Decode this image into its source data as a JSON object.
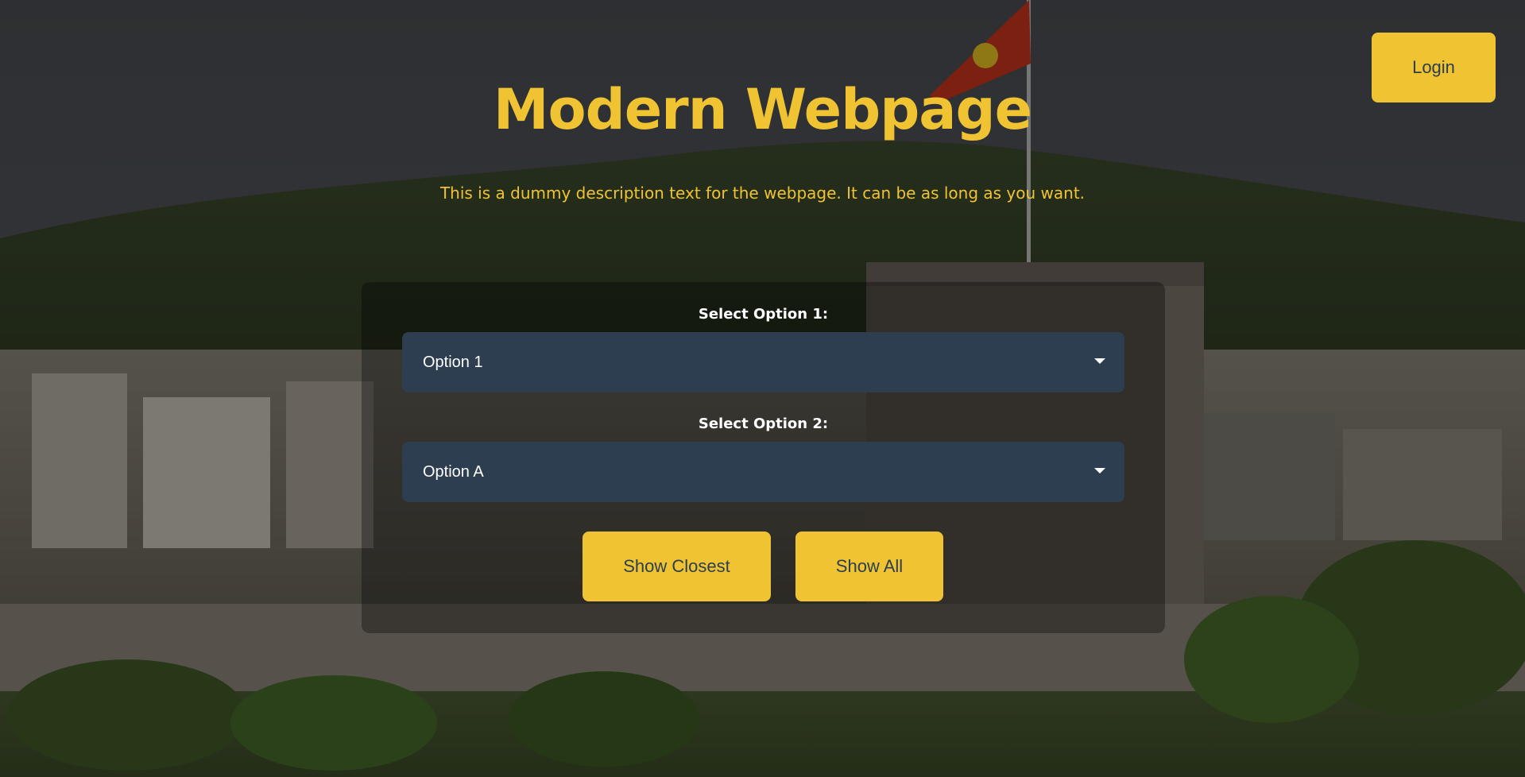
{
  "header": {
    "login_label": "Login"
  },
  "hero": {
    "title": "Modern Webpage",
    "description": "This is a dummy description text for the webpage. It can be as long as you want."
  },
  "form": {
    "option1": {
      "label": "Select Option 1:",
      "selected_value": "Option 1"
    },
    "option2": {
      "label": "Select Option 2:",
      "selected_value": "Option A"
    },
    "buttons": {
      "show_closest_label": "Show Closest",
      "show_all_label": "Show All"
    }
  },
  "icons": {
    "select_caret": "chevron-down-icon"
  },
  "colors": {
    "accent": "#f0c332",
    "select_background": "#2c3e50",
    "button_text": "#2c3e50",
    "label_text": "#ffffff"
  }
}
